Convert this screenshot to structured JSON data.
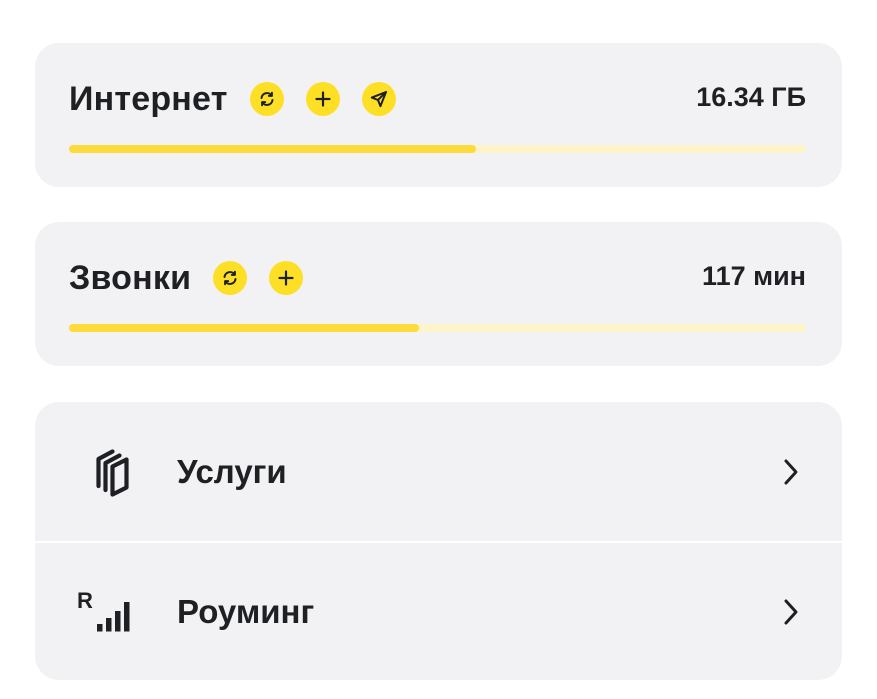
{
  "internet": {
    "title": "Интернет",
    "amount": "16.34 ГБ",
    "progress": 0.552,
    "actions": [
      "refresh-icon",
      "plus-icon",
      "send-icon"
    ]
  },
  "calls": {
    "title": "Звонки",
    "amount": "117 мин",
    "progress": 0.475,
    "actions": [
      "refresh-icon",
      "plus-icon"
    ]
  },
  "menu": {
    "items": [
      {
        "label": "Услуги",
        "icon": "layers-icon"
      },
      {
        "label": "Роуминг",
        "icon": "roaming-signal-icon"
      }
    ]
  },
  "colors": {
    "accent": "#fde026",
    "progress_fill": "#fddb3a",
    "progress_track": "#fdf4c9",
    "card_bg": "#f2f2f5",
    "text": "#1f2023"
  }
}
